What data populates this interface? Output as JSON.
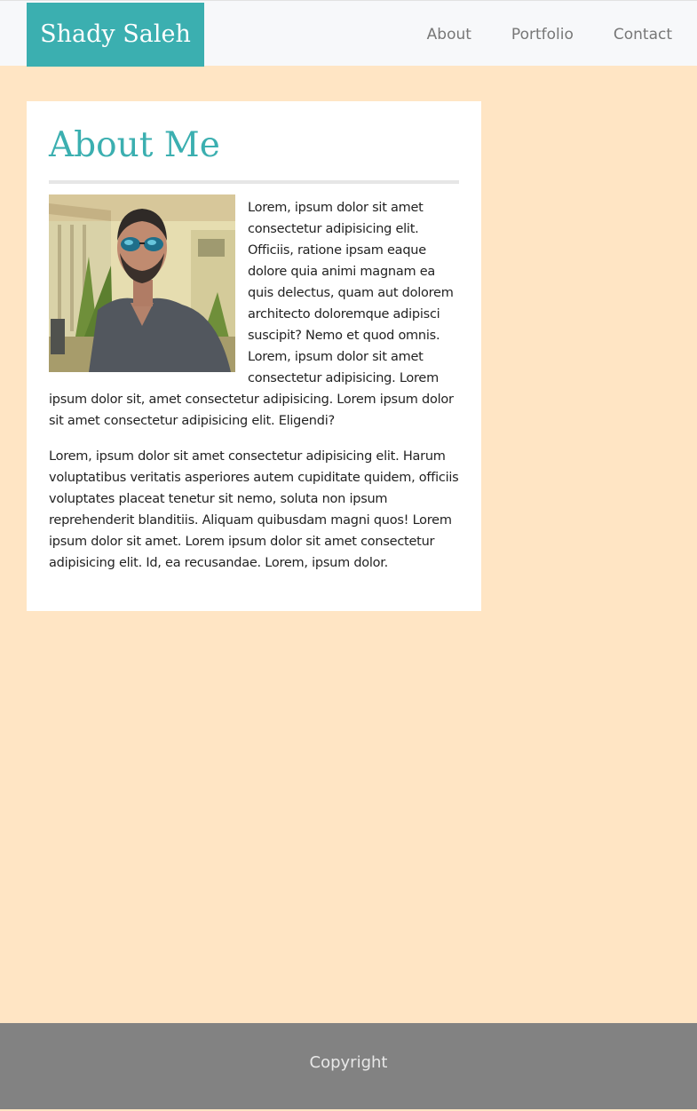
{
  "header": {
    "brand": "Shady Saleh",
    "nav": [
      "About",
      "Portfolio",
      "Contact"
    ]
  },
  "about": {
    "title": "About Me",
    "paragraph1": "Lorem, ipsum dolor sit amet consectetur adipisicing elit. Officiis, ratione ipsam eaque dolore quia animi magnam ea quis delectus, quam aut dolorem architecto doloremque adipisci suscipit? Nemo et quod omnis. Lorem, ipsum dolor sit amet consectetur adipisicing. Lorem ipsum dolor sit, amet consectetur adipisicing. Lorem ipsum dolor sit amet consectetur adipisicing elit. Eligendi?",
    "paragraph2": "Lorem, ipsum dolor sit amet consectetur adipisicing elit. Harum voluptatibus veritatis asperiores autem cupiditate quidem, officiis voluptates placeat tenetur sit nemo, soluta non ipsum reprehenderit blanditiis. Aliquam quibusdam magni quos! Lorem ipsum dolor sit amet. Lorem ipsum dolor sit amet consectetur adipisicing elit. Id, ea recusandae. Lorem, ipsum dolor."
  },
  "footer": {
    "text": "Copyright"
  },
  "colors": {
    "background": "#ffe5c4",
    "accent": "#3bafb0",
    "footer": "#828282",
    "navbar": "#f7f8fa"
  }
}
